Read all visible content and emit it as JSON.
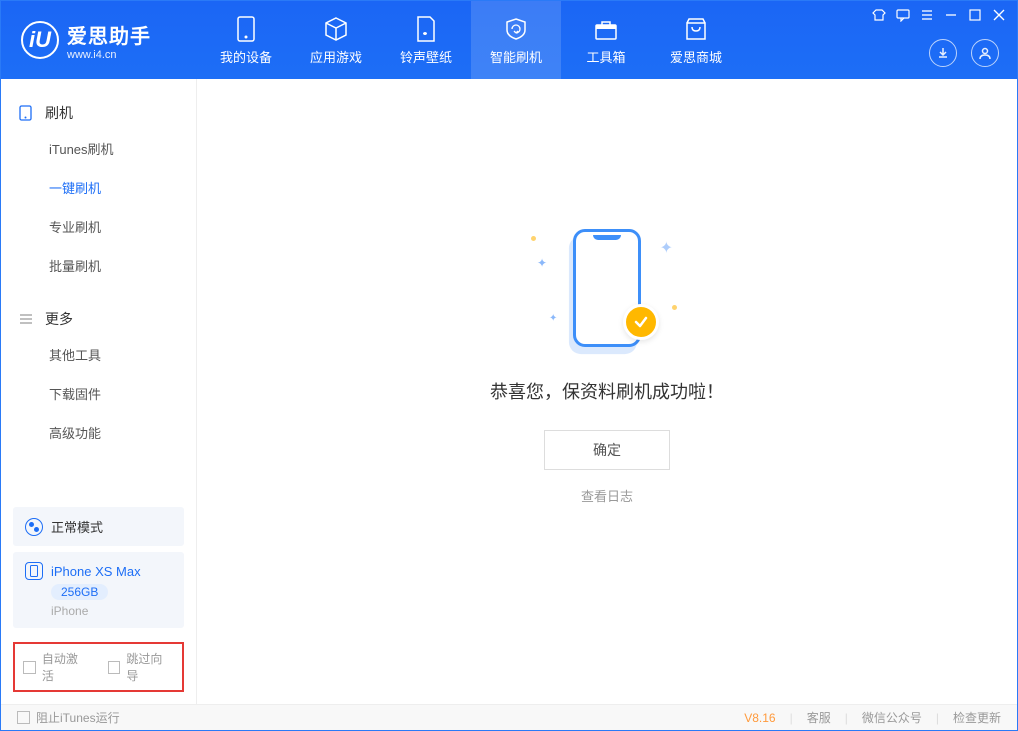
{
  "app": {
    "title": "爱思助手",
    "subtitle": "www.i4.cn"
  },
  "nav": {
    "tabs": [
      {
        "label": "我的设备"
      },
      {
        "label": "应用游戏"
      },
      {
        "label": "铃声壁纸"
      },
      {
        "label": "智能刷机"
      },
      {
        "label": "工具箱"
      },
      {
        "label": "爱思商城"
      }
    ]
  },
  "sidebar": {
    "sections": [
      {
        "title": "刷机",
        "items": [
          {
            "label": "iTunes刷机"
          },
          {
            "label": "一键刷机"
          },
          {
            "label": "专业刷机"
          },
          {
            "label": "批量刷机"
          }
        ]
      },
      {
        "title": "更多",
        "items": [
          {
            "label": "其他工具"
          },
          {
            "label": "下载固件"
          },
          {
            "label": "高级功能"
          }
        ]
      }
    ],
    "mode": "正常模式",
    "device": {
      "name": "iPhone XS Max",
      "storage": "256GB",
      "type": "iPhone"
    },
    "checkboxes": {
      "auto_activate": "自动激活",
      "skip_guide": "跳过向导"
    }
  },
  "main": {
    "success_message": "恭喜您，保资料刷机成功啦！",
    "confirm_label": "确定",
    "log_link": "查看日志"
  },
  "footer": {
    "block_itunes": "阻止iTunes运行",
    "version": "V8.16",
    "links": {
      "service": "客服",
      "wechat": "微信公众号",
      "update": "检查更新"
    }
  }
}
